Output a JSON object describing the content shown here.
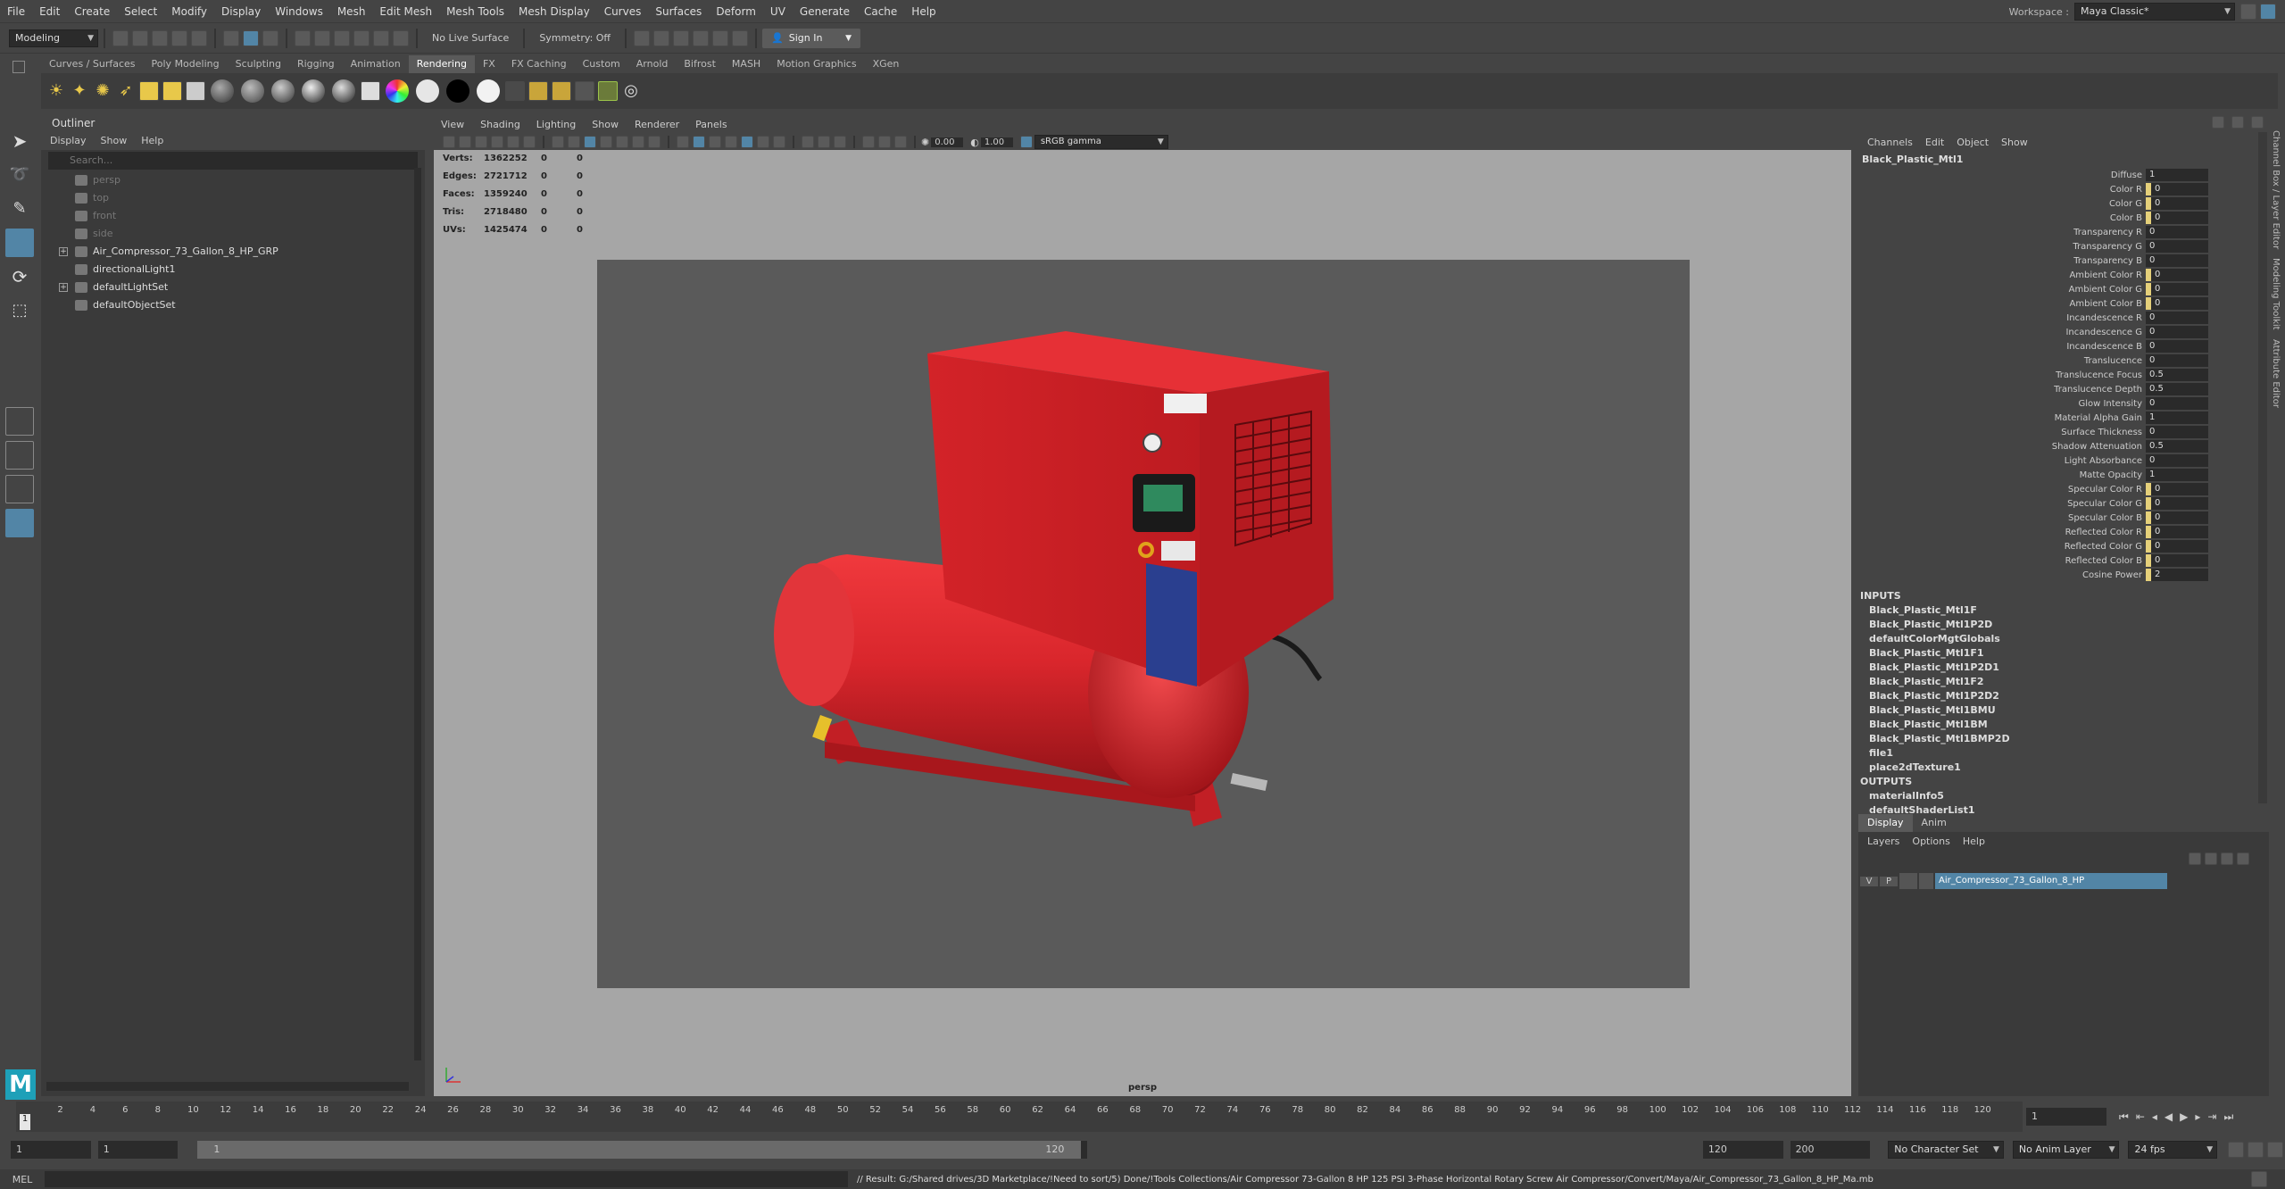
{
  "menubar": {
    "items": [
      "File",
      "Edit",
      "Create",
      "Select",
      "Modify",
      "Display",
      "Windows",
      "Mesh",
      "Edit Mesh",
      "Mesh Tools",
      "Mesh Display",
      "Curves",
      "Surfaces",
      "Deform",
      "UV",
      "Generate",
      "Cache",
      "Help"
    ],
    "workspace_label": "Workspace :",
    "workspace_value": "Maya Classic*"
  },
  "statusline": {
    "mode": "Modeling",
    "live_surface": "No Live Surface",
    "symmetry": "Symmetry: Off",
    "sign_in": "Sign In"
  },
  "shelf": {
    "tabs": [
      "Curves / Surfaces",
      "Poly Modeling",
      "Sculpting",
      "Rigging",
      "Animation",
      "Rendering",
      "FX",
      "FX Caching",
      "Custom",
      "Arnold",
      "Bifrost",
      "MASH",
      "Motion Graphics",
      "XGen"
    ],
    "active_tab": "Rendering"
  },
  "outliner": {
    "title": "Outliner",
    "menu": [
      "Display",
      "Show",
      "Help"
    ],
    "search_placeholder": "Search...",
    "nodes": [
      {
        "label": "persp",
        "dim": true,
        "expandable": false
      },
      {
        "label": "top",
        "dim": true,
        "expandable": false
      },
      {
        "label": "front",
        "dim": true,
        "expandable": false
      },
      {
        "label": "side",
        "dim": true,
        "expandable": false
      },
      {
        "label": "Air_Compressor_73_Gallon_8_HP_GRP",
        "dim": false,
        "expandable": true
      },
      {
        "label": "directionalLight1",
        "dim": false,
        "expandable": false
      },
      {
        "label": "defaultLightSet",
        "dim": false,
        "expandable": true
      },
      {
        "label": "defaultObjectSet",
        "dim": false,
        "expandable": false
      }
    ]
  },
  "viewport": {
    "menu": [
      "View",
      "Shading",
      "Lighting",
      "Show",
      "Renderer",
      "Panels"
    ],
    "exposure": "0.00",
    "gamma": "1.00",
    "color_space": "sRGB gamma",
    "camera": "persp",
    "hud": [
      {
        "label": "Verts:",
        "value": "1362252",
        "sel": "0",
        "comp": "0"
      },
      {
        "label": "Edges:",
        "value": "2721712",
        "sel": "0",
        "comp": "0"
      },
      {
        "label": "Faces:",
        "value": "1359240",
        "sel": "0",
        "comp": "0"
      },
      {
        "label": "Tris:",
        "value": "2718480",
        "sel": "0",
        "comp": "0"
      },
      {
        "label": "UVs:",
        "value": "1425474",
        "sel": "0",
        "comp": "0"
      }
    ],
    "colors": {
      "model_red": "#d9262c",
      "panel_blue": "#2a3f8f"
    }
  },
  "channelbox": {
    "menu": [
      "Channels",
      "Edit",
      "Object",
      "Show"
    ],
    "node": "Black_Plastic_Mtl1",
    "attrs": [
      {
        "name": "Diffuse",
        "value": "1",
        "hl": false
      },
      {
        "name": "Color R",
        "value": "0",
        "hl": true
      },
      {
        "name": "Color G",
        "value": "0",
        "hl": true
      },
      {
        "name": "Color B",
        "value": "0",
        "hl": true
      },
      {
        "name": "Transparency R",
        "value": "0",
        "hl": false
      },
      {
        "name": "Transparency G",
        "value": "0",
        "hl": false
      },
      {
        "name": "Transparency B",
        "value": "0",
        "hl": false
      },
      {
        "name": "Ambient Color R",
        "value": "0",
        "hl": true
      },
      {
        "name": "Ambient Color G",
        "value": "0",
        "hl": true
      },
      {
        "name": "Ambient Color B",
        "value": "0",
        "hl": true
      },
      {
        "name": "Incandescence R",
        "value": "0",
        "hl": false
      },
      {
        "name": "Incandescence G",
        "value": "0",
        "hl": false
      },
      {
        "name": "Incandescence B",
        "value": "0",
        "hl": false
      },
      {
        "name": "Translucence",
        "value": "0",
        "hl": false
      },
      {
        "name": "Translucence Focus",
        "value": "0.5",
        "hl": false
      },
      {
        "name": "Translucence Depth",
        "value": "0.5",
        "hl": false
      },
      {
        "name": "Glow Intensity",
        "value": "0",
        "hl": false
      },
      {
        "name": "Material Alpha Gain",
        "value": "1",
        "hl": false
      },
      {
        "name": "Surface Thickness",
        "value": "0",
        "hl": false
      },
      {
        "name": "Shadow Attenuation",
        "value": "0.5",
        "hl": false
      },
      {
        "name": "Light Absorbance",
        "value": "0",
        "hl": false
      },
      {
        "name": "Matte Opacity",
        "value": "1",
        "hl": false
      },
      {
        "name": "Specular Color R",
        "value": "0",
        "hl": true
      },
      {
        "name": "Specular Color G",
        "value": "0",
        "hl": true
      },
      {
        "name": "Specular Color B",
        "value": "0",
        "hl": true
      },
      {
        "name": "Reflected Color R",
        "value": "0",
        "hl": true
      },
      {
        "name": "Reflected Color G",
        "value": "0",
        "hl": true
      },
      {
        "name": "Reflected Color B",
        "value": "0",
        "hl": true
      },
      {
        "name": "Cosine Power",
        "value": "2",
        "hl": true
      }
    ],
    "inputs_label": "INPUTS",
    "inputs": [
      "Black_Plastic_Mtl1F",
      "Black_Plastic_Mtl1P2D",
      "defaultColorMgtGlobals",
      "Black_Plastic_Mtl1F1",
      "Black_Plastic_Mtl1P2D1",
      "Black_Plastic_Mtl1F2",
      "Black_Plastic_Mtl1P2D2",
      "Black_Plastic_Mtl1BMU",
      "Black_Plastic_Mtl1BM",
      "Black_Plastic_Mtl1BMP2D",
      "file1",
      "place2dTexture1"
    ],
    "outputs_label": "OUTPUTS",
    "outputs": [
      "materialInfo5",
      "defaultShaderList1"
    ]
  },
  "layers": {
    "tabs": [
      "Display",
      "Anim"
    ],
    "menu": [
      "Layers",
      "Options",
      "Help"
    ],
    "layer_v": "V",
    "layer_p": "P",
    "layer_name": "Air_Compressor_73_Gallon_8_HP"
  },
  "right_tabs": [
    "Channel Box / Layer Editor",
    "Modeling Toolkit",
    "Attribute Editor"
  ],
  "timeline": {
    "ticks": [
      "2",
      "4",
      "6",
      "8",
      "10",
      "12",
      "14",
      "16",
      "18",
      "20",
      "22",
      "24",
      "26",
      "28",
      "30",
      "32",
      "34",
      "36",
      "38",
      "40",
      "42",
      "44",
      "46",
      "48",
      "50",
      "52",
      "54",
      "56",
      "58",
      "60",
      "62",
      "64",
      "66",
      "68",
      "70",
      "72",
      "74",
      "76",
      "78",
      "80",
      "82",
      "84",
      "86",
      "88",
      "90",
      "92",
      "94",
      "96",
      "98",
      "100",
      "102",
      "104",
      "106",
      "108",
      "110",
      "112",
      "114",
      "116",
      "118",
      "120"
    ],
    "current_marker": "1",
    "current_frame": "1"
  },
  "range": {
    "start": "1",
    "anim_start": "1",
    "slider_start": "1",
    "slider_end": "120",
    "end": "120",
    "anim_end": "200",
    "character_set": "No Character Set",
    "anim_layer": "No Anim Layer",
    "fps": "24 fps"
  },
  "cmdline": {
    "lang": "MEL",
    "result": "// Result: G:/Shared drives/3D Marketplace/!Need to sort/5) Done/!Tools Collections/Air Compressor 73-Gallon 8 HP 125 PSI 3-Phase Horizontal Rotary Screw Air Compressor/Convert/Maya/Air_Compressor_73_Gallon_8_HP_Ma.mb"
  }
}
